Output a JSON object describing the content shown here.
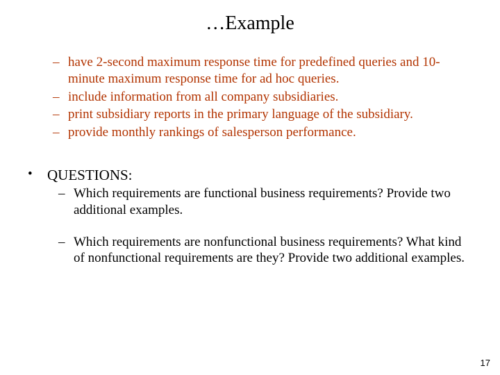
{
  "title": "…Example",
  "top_items": [
    "have 2-second maximum response time for predefined queries and 10-minute maximum response time for ad hoc queries.",
    "include information from all company subsidiaries.",
    "print subsidiary reports in the primary language of the subsidiary.",
    "provide monthly rankings of salesperson performance."
  ],
  "questions": {
    "label": "QUESTIONS:",
    "items": [
      "Which requirements are functional business requirements? Provide two additional examples.",
      "Which requirements are nonfunctional business requirements? What kind of nonfunctional requirements are they? Provide two additional examples."
    ]
  },
  "page_number": "17",
  "dash": "–",
  "dot": "•"
}
